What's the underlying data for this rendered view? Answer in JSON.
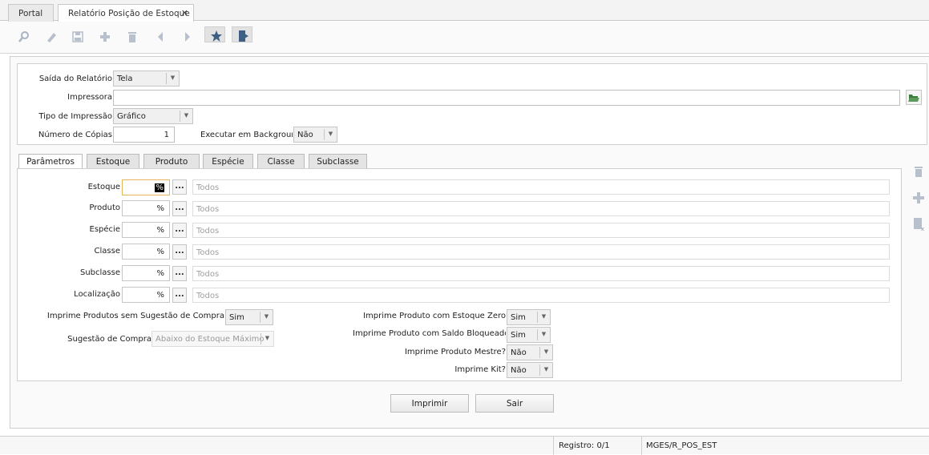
{
  "tabs": [
    {
      "label": "Portal",
      "active": false
    },
    {
      "label": "Relatório Posição de Estoque",
      "active": true,
      "close": "×"
    }
  ],
  "toolbar": {
    "icons": [
      "search-icon",
      "edit-icon",
      "save-icon",
      "add-icon",
      "delete-icon",
      "previous-icon",
      "next-icon",
      "favorite-star-icon",
      "exit-icon"
    ]
  },
  "output": {
    "saida_label": "Saída do Relatório",
    "saida_value": "Tela",
    "impressora_label": "Impressora",
    "impressora_value": "",
    "tipo_label": "Tipo de Impressão",
    "tipo_value": "Gráfico",
    "copias_label": "Número de Cópias",
    "copias_value": "1",
    "background_label": "Executar em Background",
    "background_value": "Não"
  },
  "subtabs": [
    "Parâmetros",
    "Estoque",
    "Produto",
    "Espécie",
    "Classe",
    "Subclasse"
  ],
  "params": [
    {
      "label": "Estoque",
      "value": "%",
      "desc": "Todos"
    },
    {
      "label": "Produto",
      "value": "%",
      "desc": "Todos"
    },
    {
      "label": "Espécie",
      "value": "%",
      "desc": "Todos"
    },
    {
      "label": "Classe",
      "value": "%",
      "desc": "Todos"
    },
    {
      "label": "Subclasse",
      "value": "%",
      "desc": "Todos"
    },
    {
      "label": "Localização",
      "value": "%",
      "desc": "Todos"
    }
  ],
  "dots_label": "...",
  "options_left": [
    {
      "label": "Imprime Produtos sem Sugestão de Compra",
      "value": "Sim"
    },
    {
      "label": "Sugestão de Compra",
      "value": "Abaixo do Estoque Máximo"
    }
  ],
  "options_right": [
    {
      "label": "Imprime Produto com Estoque Zero",
      "value": "Sim"
    },
    {
      "label": "Imprime Produto com Saldo Bloqueado",
      "value": "Sim"
    },
    {
      "label": "Imprime Produto Mestre?",
      "value": "Não"
    },
    {
      "label": "Imprime Kit?",
      "value": "Não"
    }
  ],
  "buttons": {
    "imprimir": "Imprimir",
    "sair": "Sair"
  },
  "status": {
    "registro": "Registro: 0/1",
    "program": "MGES/R_POS_EST"
  },
  "colors": {
    "accent": "#3d5f86",
    "folder": "#3c7a3c",
    "focus": "#e8b45a"
  }
}
